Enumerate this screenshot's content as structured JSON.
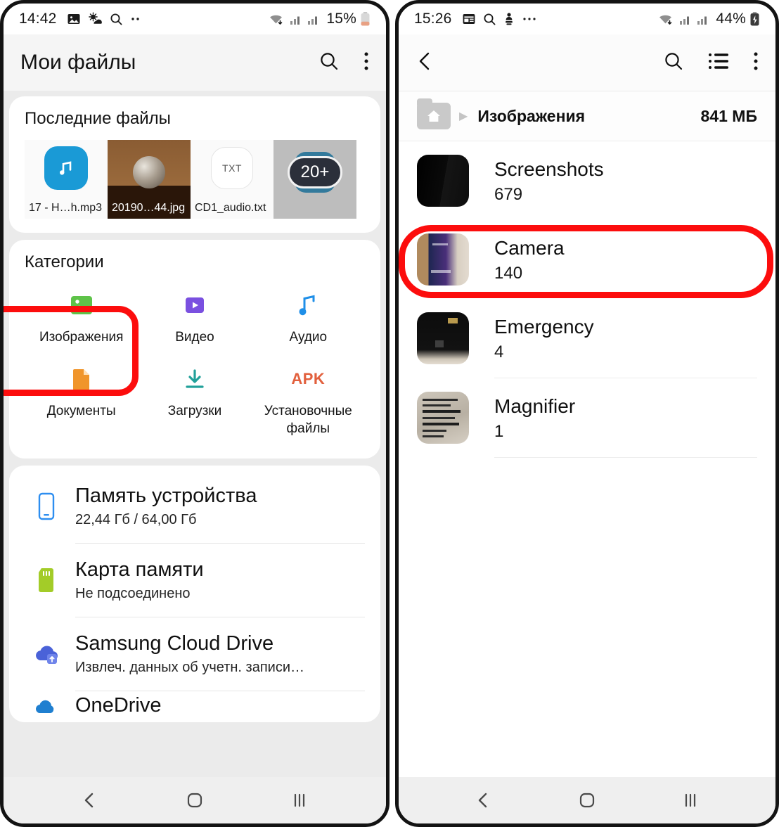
{
  "left_phone": {
    "status_bar": {
      "time": "14:42",
      "battery_percent": "15%",
      "icons": [
        "gallery-icon",
        "weather-icon",
        "search-icon",
        "more-dots-icon",
        "wifi-icon",
        "signal-icon-1",
        "signal-icon-2",
        "battery-icon"
      ]
    },
    "app_bar": {
      "title": "Мои файлы",
      "icons": [
        "search-icon",
        "overflow-menu-icon"
      ]
    },
    "recent_files": {
      "title": "Последние файлы",
      "items": [
        {
          "name": "17 - H…h.mp3",
          "thumb": "audio-note-icon"
        },
        {
          "name": "20190…44.jpg",
          "thumb": "clock-photo"
        },
        {
          "name": "CD1_audio.txt",
          "thumb": "txt-badge",
          "badge": "TXT"
        },
        {
          "name": "",
          "thumb": "more-count-badge",
          "badge": "20+"
        }
      ]
    },
    "categories": {
      "title": "Категории",
      "items": [
        {
          "label": "Изображения",
          "icon": "image-icon",
          "color": "#5ec349",
          "highlighted": true
        },
        {
          "label": "Видео",
          "icon": "video-icon",
          "color": "#7a50e0"
        },
        {
          "label": "Аудио",
          "icon": "audio-note-icon",
          "color": "#1f8fe8"
        },
        {
          "label": "Документы",
          "icon": "document-icon",
          "color": "#f0952b"
        },
        {
          "label": "Загрузки",
          "icon": "download-icon",
          "color": "#22a19a"
        },
        {
          "label": "Установочные файлы",
          "icon": "apk-icon",
          "color": "#e2603d",
          "badge_text": "APK"
        }
      ]
    },
    "storage": [
      {
        "name": "Память устройства",
        "sub": "22,44 Гб / 64,00 Гб",
        "icon": "phone-icon",
        "color": "#2d8ef0"
      },
      {
        "name": "Карта памяти",
        "sub": "Не подсоединено",
        "icon": "sd-card-icon",
        "color": "#a3cc28"
      },
      {
        "name": "Samsung Cloud Drive",
        "sub": "Извлеч. данных об учетн. записи…",
        "icon": "cloud-upload-icon",
        "color": "#4a62d8"
      },
      {
        "name": "OneDrive",
        "sub": "",
        "icon": "onedrive-icon",
        "color": "#1f7fd0"
      }
    ],
    "nav_bar": {
      "back": "back-icon",
      "home": "home-icon",
      "recents": "recents-icon"
    }
  },
  "right_phone": {
    "status_bar": {
      "time": "15:26",
      "battery_percent": "44%",
      "icons": [
        "calendar-icon",
        "search-icon",
        "download-manager-icon",
        "more-dots-icon",
        "wifi-icon",
        "signal-icon-1",
        "signal-icon-2",
        "battery-charging-icon"
      ]
    },
    "app_bar": {
      "icons": [
        "back-icon",
        "search-icon",
        "list-view-icon",
        "overflow-menu-icon"
      ]
    },
    "breadcrumb": {
      "home_icon": "home-folder-icon",
      "separator": "▶",
      "path": "Изображения",
      "size": "841 МБ"
    },
    "folders": [
      {
        "name": "Screenshots",
        "count": "679",
        "thumb": "screenshots",
        "highlighted": false
      },
      {
        "name": "Camera",
        "count": "140",
        "thumb": "camera",
        "highlighted": true
      },
      {
        "name": "Emergency",
        "count": "4",
        "thumb": "emergency",
        "highlighted": false
      },
      {
        "name": "Magnifier",
        "count": "1",
        "thumb": "magnifier",
        "highlighted": false
      }
    ],
    "nav_bar": {
      "back": "back-icon",
      "home": "home-icon",
      "recents": "recents-icon"
    }
  },
  "annotations": {
    "highlight_color": "#fc0d0d",
    "targets": [
      "Изображения",
      "Camera"
    ]
  }
}
